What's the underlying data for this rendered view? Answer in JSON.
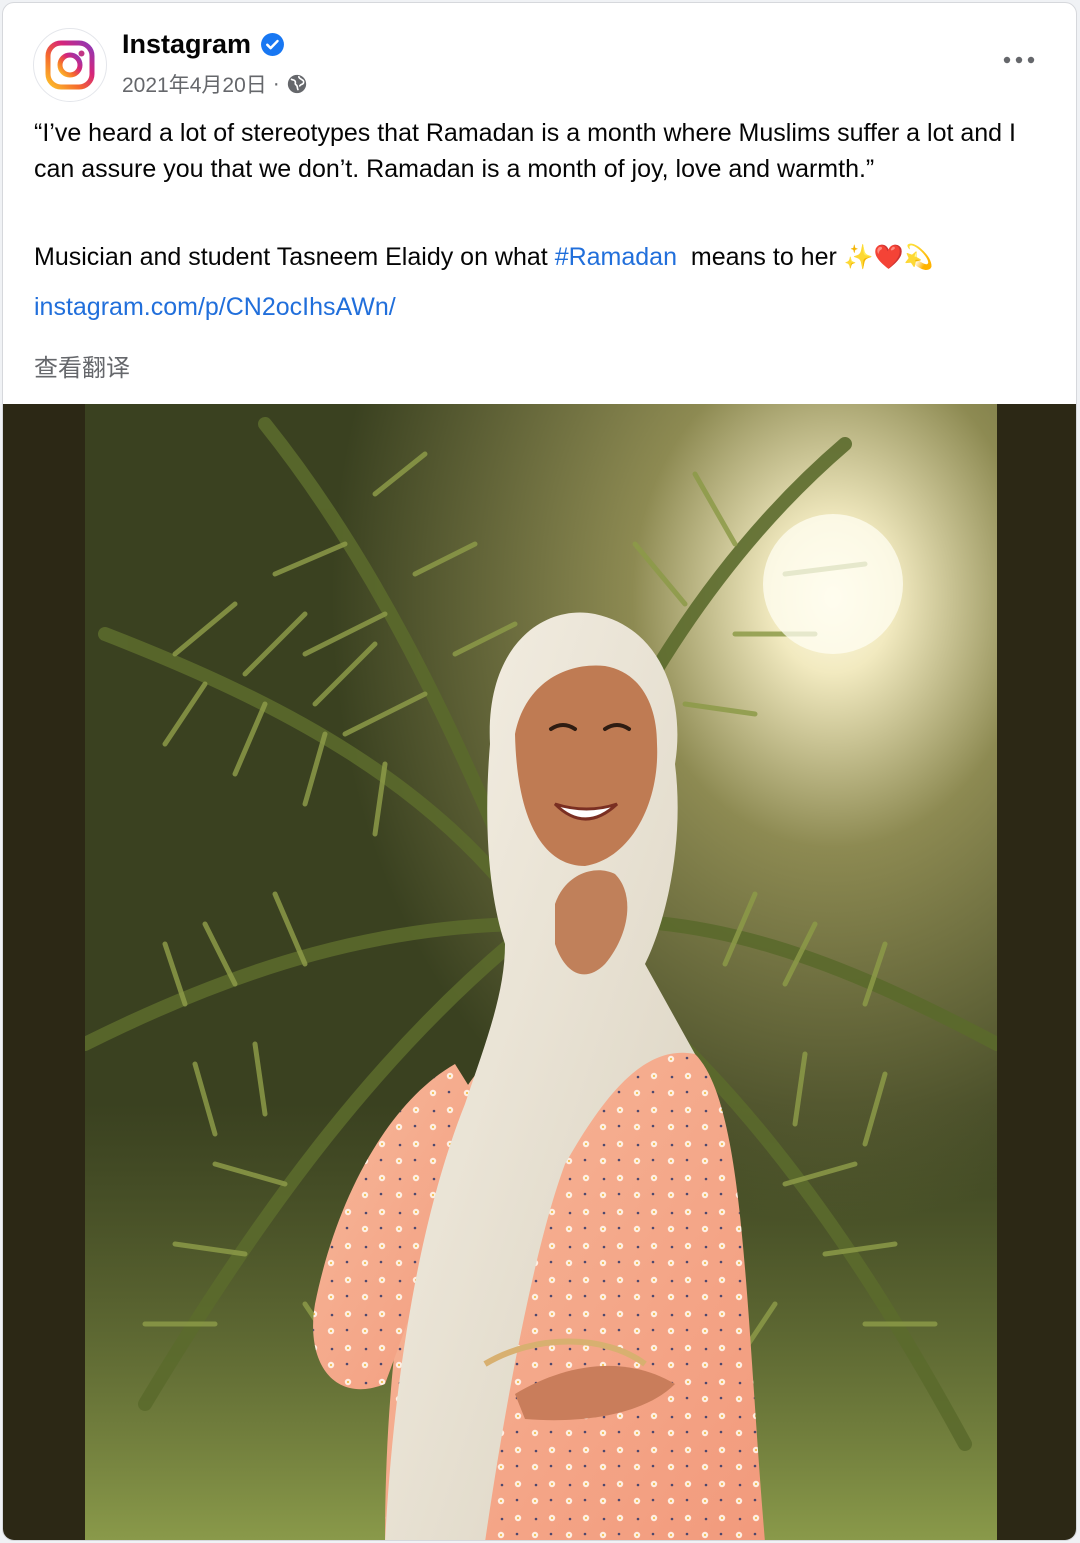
{
  "post": {
    "page_name": "Instagram",
    "verified_icon": "verified-badge-icon",
    "date": "2021年4月20日",
    "separator": "·",
    "audience_icon": "globe-icon",
    "more_icon": "more-options-icon",
    "quote": "“I’ve heard a lot of stereotypes that Ramadan is a month where Muslims suffer a lot and I can assure you that we don’t. Ramadan is a month of joy, love and warmth.”",
    "caption_before": "Musician and student Tasneem Elaidy on what ",
    "hashtag": "#Ramadan",
    "caption_after": "  means to her ",
    "emojis": "✨❤️💫",
    "link": "instagram.com/p/CN2ocIhsAWn/",
    "translate_label": "查看翻译",
    "photo_icon": "post-photo"
  },
  "colors": {
    "link": "#216fdb",
    "secondary_text": "#65676b",
    "verified": "#1877f2",
    "photo_backdrop": "#2c2815"
  }
}
